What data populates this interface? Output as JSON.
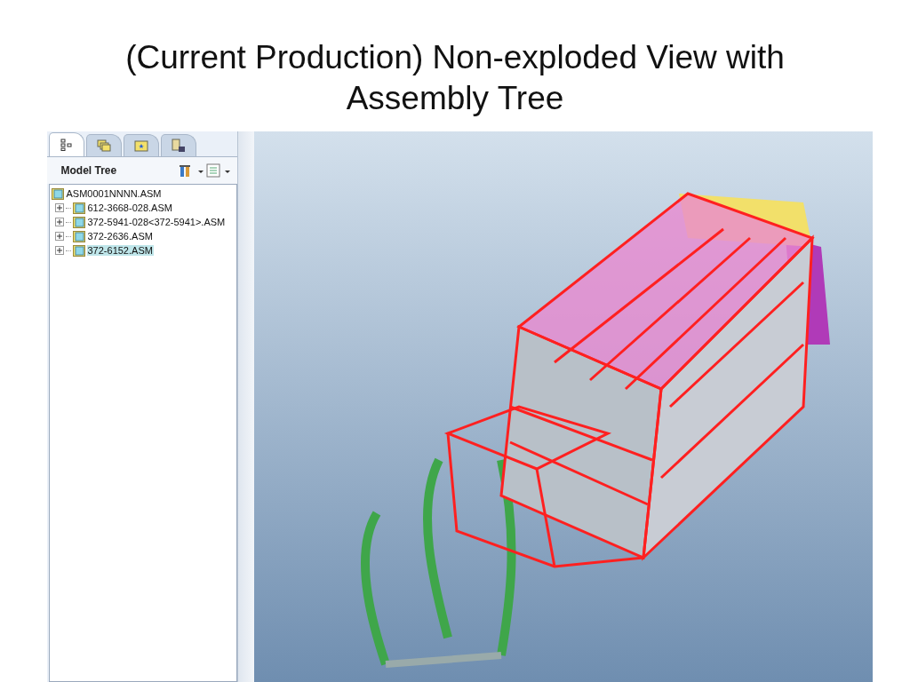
{
  "slide_title": "(Current Production) Non-exploded View with Assembly Tree",
  "panel": {
    "tabs": [
      {
        "kind": "tree",
        "selected": true
      },
      {
        "kind": "layers",
        "selected": false
      },
      {
        "kind": "folder",
        "selected": false
      },
      {
        "kind": "cabinet",
        "selected": false
      }
    ],
    "title": "Model Tree",
    "tree": {
      "label": "ASM0001NNNN.ASM",
      "children": [
        {
          "label": "612-3668-028.ASM",
          "expanded": false,
          "selected": false
        },
        {
          "label": "372-5941-028<372-5941>.ASM",
          "expanded": false,
          "selected": false
        },
        {
          "label": "372-2636.ASM",
          "expanded": false,
          "selected": false
        },
        {
          "label": "372-6152.ASM",
          "expanded": false,
          "selected": true
        }
      ]
    }
  }
}
